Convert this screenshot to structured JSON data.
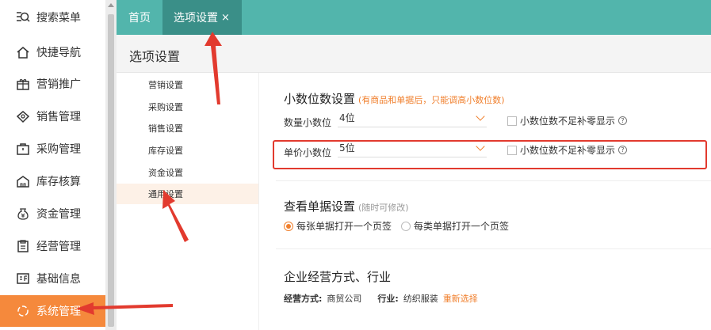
{
  "sidebar": {
    "items": [
      {
        "label": "搜索菜单",
        "icon": "search-menu-icon",
        "active": false
      },
      {
        "label": "快捷导航",
        "icon": "home-icon",
        "active": false
      },
      {
        "label": "营销推广",
        "icon": "gift-icon",
        "active": false
      },
      {
        "label": "销售管理",
        "icon": "sales-icon",
        "active": false
      },
      {
        "label": "采购管理",
        "icon": "bag-icon",
        "active": false
      },
      {
        "label": "库存核算",
        "icon": "warehouse-icon",
        "active": false
      },
      {
        "label": "资金管理",
        "icon": "money-icon",
        "active": false
      },
      {
        "label": "经营管理",
        "icon": "clipboard-icon",
        "active": false
      },
      {
        "label": "基础信息",
        "icon": "info-card-icon",
        "active": false
      },
      {
        "label": "系统管理",
        "icon": "settings-icon",
        "active": true
      }
    ]
  },
  "tabs": {
    "home": "首页",
    "current": "选项设置",
    "close": "×"
  },
  "page": {
    "title": "选项设置"
  },
  "submenu": {
    "items": [
      {
        "label": "营销设置",
        "active": false
      },
      {
        "label": "采购设置",
        "active": false
      },
      {
        "label": "销售设置",
        "active": false
      },
      {
        "label": "库存设置",
        "active": false
      },
      {
        "label": "资金设置",
        "active": false
      },
      {
        "label": "通用设置",
        "active": true
      }
    ]
  },
  "decimal": {
    "title": "小数位数设置",
    "hint": "(有商品和单据后，只能调高小数位数)",
    "qty_label": "数量小数位",
    "qty_value": "4位",
    "qty_checkbox": "小数位数不足补零显示",
    "price_label": "单价小数位",
    "price_value": "5位",
    "price_checkbox": "小数位数不足补零显示",
    "help": "?"
  },
  "view": {
    "title": "查看单据设置",
    "hint": "(随时可修改)",
    "option1": "每张单据打开一个页签",
    "option2": "每类单据打开一个页签",
    "selected": 1
  },
  "business": {
    "title": "企业经营方式、行业",
    "mode_label": "经营方式:",
    "mode_value": "商贸公司",
    "industry_label": "行业:",
    "industry_value": "纺织服装",
    "reselect": "重新选择"
  },
  "colors": {
    "accent": "#f07f2c",
    "topbar": "#52b5ac",
    "active_tab": "#3a8f88",
    "sidebar_active": "#f5893c",
    "annotation_red": "#e23a2e"
  }
}
